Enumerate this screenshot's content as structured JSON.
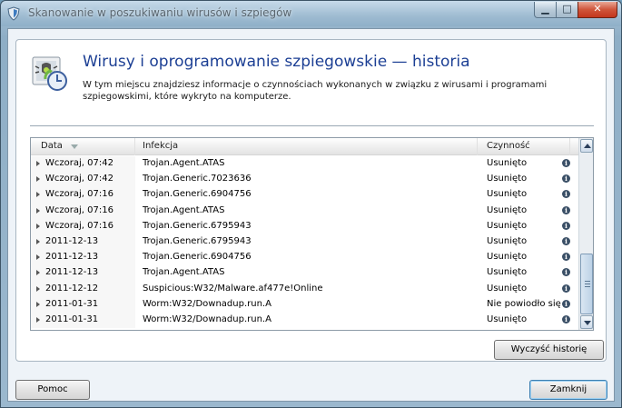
{
  "window": {
    "title": "Skanowanie w poszukiwaniu wirusów i szpiegów",
    "min_glyph": "▁",
    "max_glyph": "□",
    "close_glyph": "✕"
  },
  "header": {
    "title": "Wirusy i oprogramowanie szpiegowskie — historia",
    "description": "W tym miejscu znajdziesz informacje o czynnościach wykonanych w związku z wirusami i programami szpiegowskimi, które wykryto na komputerze."
  },
  "table": {
    "columns": {
      "date": "Data",
      "infection": "Infekcja",
      "action": "Czynność"
    },
    "rows": [
      {
        "date": "Wczoraj, 07:42",
        "infection": "Trojan.Agent.ATAS",
        "action": "Usunięto"
      },
      {
        "date": "Wczoraj, 07:42",
        "infection": "Trojan.Generic.7023636",
        "action": "Usunięto"
      },
      {
        "date": "Wczoraj, 07:16",
        "infection": "Trojan.Generic.6904756",
        "action": "Usunięto"
      },
      {
        "date": "Wczoraj, 07:16",
        "infection": "Trojan.Agent.ATAS",
        "action": "Usunięto"
      },
      {
        "date": "Wczoraj, 07:16",
        "infection": "Trojan.Generic.6795943",
        "action": "Usunięto"
      },
      {
        "date": "2011-12-13",
        "infection": "Trojan.Generic.6795943",
        "action": "Usunięto"
      },
      {
        "date": "2011-12-13",
        "infection": "Trojan.Generic.6904756",
        "action": "Usunięto"
      },
      {
        "date": "2011-12-13",
        "infection": "Trojan.Agent.ATAS",
        "action": "Usunięto"
      },
      {
        "date": "2011-12-12",
        "infection": "Suspicious:W32/Malware.af477e!Online",
        "action": "Usunięto"
      },
      {
        "date": "2011-01-31",
        "infection": "Worm:W32/Downadup.run.A",
        "action": "Nie powiodło się"
      },
      {
        "date": "2011-01-31",
        "infection": "Worm:W32/Downadup.run.A",
        "action": "Usunięto"
      }
    ]
  },
  "buttons": {
    "clear_history": "Wyczyść historię",
    "help": "Pomoc",
    "close": "Zamknij"
  },
  "icons": {
    "info": "info-icon",
    "app": "shield-icon",
    "header": "scan-history-icon"
  }
}
